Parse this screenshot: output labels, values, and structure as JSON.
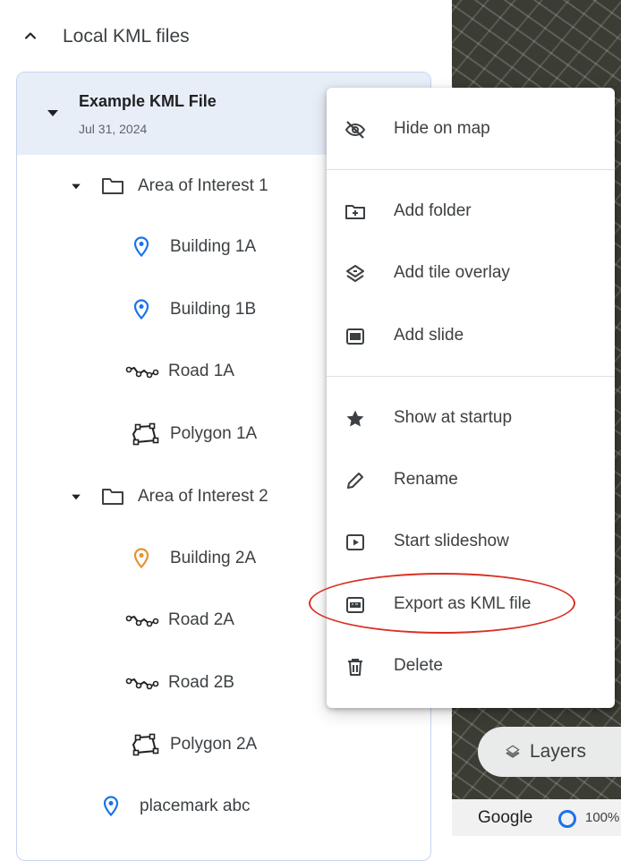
{
  "panel": {
    "section_title": "Local KML files",
    "file": {
      "name": "Example KML File",
      "date": "Jul 31, 2024"
    },
    "tree": [
      {
        "label": "Area of Interest 1",
        "type": "folder"
      },
      {
        "label": "Building 1A",
        "type": "placemark",
        "color": "#1a73e8"
      },
      {
        "label": "Building 1B",
        "type": "placemark",
        "color": "#1a73e8"
      },
      {
        "label": "Road 1A",
        "type": "path"
      },
      {
        "label": "Polygon 1A",
        "type": "polygon"
      },
      {
        "label": "Area of Interest 2",
        "type": "folder"
      },
      {
        "label": "Building 2A",
        "type": "placemark",
        "color": "#e8912d"
      },
      {
        "label": "Road 2A",
        "type": "path"
      },
      {
        "label": "Road 2B",
        "type": "path"
      },
      {
        "label": "Polygon 2A",
        "type": "polygon"
      },
      {
        "label": "placemark abc",
        "type": "placemark",
        "color": "#1a73e8"
      }
    ]
  },
  "context_menu": {
    "items": [
      {
        "label": "Hide on map",
        "icon": "eye-off-icon"
      },
      {
        "label": "Add folder",
        "icon": "folder-plus-icon"
      },
      {
        "label": "Add tile overlay",
        "icon": "layers-icon"
      },
      {
        "label": "Add slide",
        "icon": "slide-icon"
      },
      {
        "label": "Show at startup",
        "icon": "star-icon"
      },
      {
        "label": "Rename",
        "icon": "pencil-icon"
      },
      {
        "label": "Start slideshow",
        "icon": "play-box-icon"
      },
      {
        "label": "Export as KML file",
        "icon": "kml-file-icon",
        "highlighted_by_annotation": true
      },
      {
        "label": "Delete",
        "icon": "trash-icon"
      }
    ]
  },
  "map": {
    "layers_button": "Layers",
    "attribution": "Google",
    "zoom_text": "100%"
  },
  "colors": {
    "accent_blue": "#1a73e8",
    "placemark_orange": "#e8912d",
    "selected_row_bg": "#e8eef8",
    "annotation_red": "#d93025"
  }
}
